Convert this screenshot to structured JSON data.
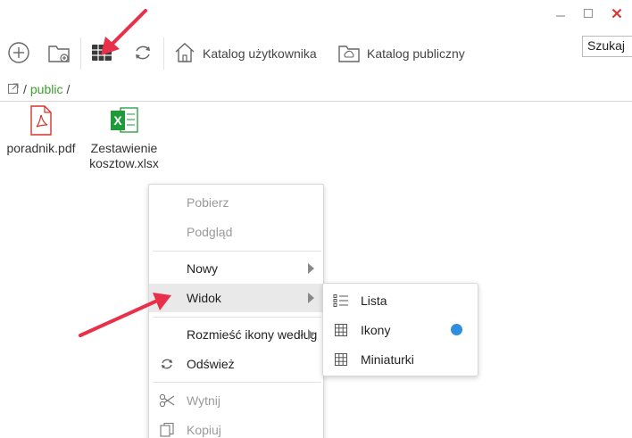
{
  "window": {
    "minimize_icon": "minimize-icon",
    "maximize_icon": "maximize-icon",
    "close_icon": "close-icon",
    "close_color": "#e0312f"
  },
  "toolbar": {
    "new_icon": "plus-circle-icon",
    "new_folder_icon": "folder-plus-icon",
    "view_icon": "grid-view-icon",
    "refresh_icon": "refresh-icon",
    "user_catalog_label": "Katalog użytkownika",
    "public_catalog_label": "Katalog publiczny",
    "search_value": "Szukaj"
  },
  "breadcrumb": {
    "root_sep": "/",
    "folder": "public",
    "trail_sep": "/"
  },
  "files": [
    {
      "name": "poradnik.pdf",
      "icon": "pdf-icon",
      "color": "#d9342b"
    },
    {
      "name_line1": "Zestawienie",
      "name_line2": "kosztow.xlsx",
      "icon": "xlsx-icon",
      "color": "#1e9a3a"
    }
  ],
  "context_menu": {
    "items": [
      {
        "label": "Pobierz",
        "disabled": true
      },
      {
        "label": "Podgląd",
        "disabled": true
      },
      {
        "label": "Nowy",
        "disabled": false,
        "submenu": true
      },
      {
        "label": "Widok",
        "disabled": false,
        "submenu": true,
        "highlighted": true
      },
      {
        "label": "Rozmieść ikony według",
        "disabled": false,
        "submenu": true
      },
      {
        "label": "Odśwież",
        "disabled": false,
        "icon": "refresh-icon"
      },
      {
        "label": "Wytnij",
        "disabled": true,
        "icon": "scissors-icon"
      },
      {
        "label": "Kopiuj",
        "disabled": true,
        "icon": "copy-icon"
      }
    ]
  },
  "view_submenu": {
    "items": [
      {
        "label": "Lista",
        "icon": "list-icon",
        "selected": false
      },
      {
        "label": "Ikony",
        "icon": "grid-icon",
        "selected": true
      },
      {
        "label": "Miniaturki",
        "icon": "grid-icon",
        "selected": false
      }
    ],
    "selected_color": "#2f8fde"
  },
  "annotations": {
    "arrow_color": "#e8304a"
  }
}
